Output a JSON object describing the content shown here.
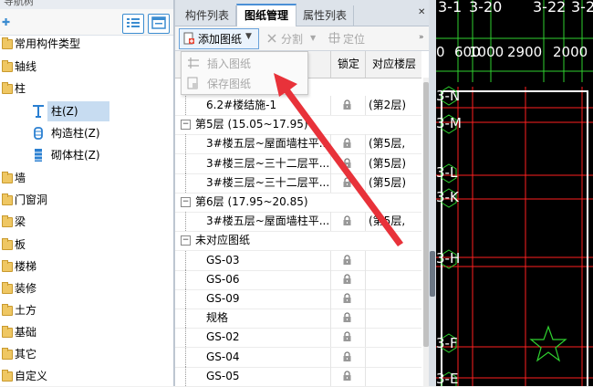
{
  "nav": {
    "title": "导航树",
    "items": [
      {
        "label": "常用构件类型"
      },
      {
        "label": "轴线"
      },
      {
        "label": "柱"
      },
      {
        "label": "柱(Z)"
      },
      {
        "label": "构造柱(Z)"
      },
      {
        "label": "砌体柱(Z)"
      },
      {
        "label": "墙"
      },
      {
        "label": "门窗洞"
      },
      {
        "label": "梁"
      },
      {
        "label": "板"
      },
      {
        "label": "楼梯"
      },
      {
        "label": "装修"
      },
      {
        "label": "土方"
      },
      {
        "label": "基础"
      },
      {
        "label": "其它"
      },
      {
        "label": "自定义"
      }
    ]
  },
  "tabs": [
    {
      "label": "构件列表"
    },
    {
      "label": "图纸管理"
    },
    {
      "label": "属性列表"
    }
  ],
  "toolbar": {
    "add_label": "添加图纸",
    "split_label": "分割",
    "locate_label": "定位"
  },
  "dropdown": {
    "insert_label": "插入图纸",
    "save_label": "保存图纸"
  },
  "table": {
    "col_lock": "锁定",
    "col_floor": "对应楼层",
    "rows": [
      {
        "name": "6.2#楼结施-1",
        "floor": "(第2层)",
        "type": "item"
      },
      {
        "name": "第5层 (15.05~17.95)",
        "floor": "",
        "type": "group"
      },
      {
        "name": "3#楼五层~屋面墙柱平...",
        "floor": "(第5层,",
        "type": "item"
      },
      {
        "name": "3#楼三层~三十二层平...",
        "floor": "(第5层)",
        "type": "item"
      },
      {
        "name": "3#楼三层~三十二层平...",
        "floor": "(第5层)",
        "type": "item"
      },
      {
        "name": "第6层 (17.95~20.85)",
        "floor": "",
        "type": "group"
      },
      {
        "name": "3#楼五层~屋面墙柱平...",
        "floor": "(第5层,",
        "type": "item"
      },
      {
        "name": "未对应图纸",
        "floor": "",
        "type": "group"
      },
      {
        "name": "GS-03",
        "floor": "",
        "type": "item"
      },
      {
        "name": "GS-06",
        "floor": "",
        "type": "item"
      },
      {
        "name": "GS-09",
        "floor": "",
        "type": "item"
      },
      {
        "name": "规格",
        "floor": "",
        "type": "item"
      },
      {
        "name": "GS-02",
        "floor": "",
        "type": "item"
      },
      {
        "name": "GS-04",
        "floor": "",
        "type": "item"
      },
      {
        "name": "GS-05",
        "floor": "",
        "type": "item"
      }
    ]
  },
  "cad": {
    "top_labels": [
      "3-1",
      "3-20",
      "3-22",
      "3-2"
    ],
    "dims": [
      "0",
      "600",
      "1000",
      "2900",
      "2000"
    ],
    "axis_labels": [
      "3-N",
      "3-M",
      "3-L",
      "3-K",
      "3-H",
      "3-F",
      "3-E"
    ]
  },
  "colors": {
    "accent": "#3b8cd0",
    "selection": "#c7dcf1",
    "folder": "#efc763",
    "annotation_arrow": "#e8323a",
    "cad_red": "#ff2020",
    "cad_green": "#2fd12f"
  }
}
